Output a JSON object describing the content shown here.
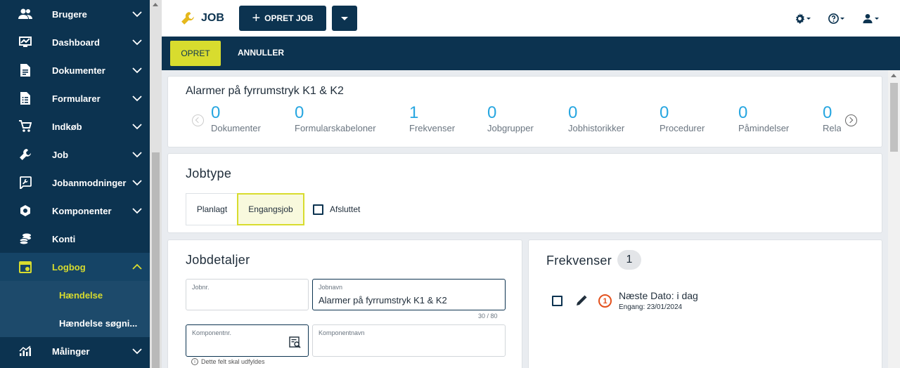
{
  "sidebar": {
    "items": [
      {
        "label": "Brugere",
        "icon": "users-icon"
      },
      {
        "label": "Dashboard",
        "icon": "dashboard-icon"
      },
      {
        "label": "Dokumenter",
        "icon": "document-icon"
      },
      {
        "label": "Formularer",
        "icon": "form-icon"
      },
      {
        "label": "Indkøb",
        "icon": "cart-icon"
      },
      {
        "label": "Job",
        "icon": "wrench-icon"
      },
      {
        "label": "Jobanmodninger",
        "icon": "request-icon"
      },
      {
        "label": "Komponenter",
        "icon": "component-icon"
      },
      {
        "label": "Konti",
        "icon": "coins-icon"
      },
      {
        "label": "Logbog",
        "icon": "logbook-icon"
      },
      {
        "label": "Målinger",
        "icon": "chart-icon"
      }
    ],
    "subitems": [
      {
        "label": "Hændelse"
      },
      {
        "label": "Hændelse søgni..."
      }
    ]
  },
  "topbar": {
    "title": "JOB",
    "create_label": "OPRET JOB"
  },
  "actionbar": {
    "create": "OPRET",
    "cancel": "ANNULLER"
  },
  "summary": {
    "title": "Alarmer på fyrrumstryk K1 & K2",
    "stats": [
      {
        "value": "0",
        "label": "Dokumenter"
      },
      {
        "value": "0",
        "label": "Formularskabeloner"
      },
      {
        "value": "1",
        "label": "Frekvenser"
      },
      {
        "value": "0",
        "label": "Jobgrupper"
      },
      {
        "value": "0",
        "label": "Jobhistorikker"
      },
      {
        "value": "0",
        "label": "Procedurer"
      },
      {
        "value": "0",
        "label": "Påmindelser"
      },
      {
        "value": "0",
        "label": "Rela"
      }
    ]
  },
  "jobtype": {
    "title": "Jobtype",
    "options": [
      "Planlagt",
      "Engangsjob"
    ],
    "selected": "Engangsjob",
    "closed_label": "Afsluttet"
  },
  "details": {
    "title": "Jobdetaljer",
    "jobnr_label": "Jobnr.",
    "jobnr_value": "",
    "jobname_label": "Jobnavn",
    "jobname_value": "Alarmer på fyrrumstryk K1 & K2",
    "jobname_counter": "30 / 80",
    "compnr_label": "Komponentnr.",
    "compname_label": "Komponentnavn",
    "required_hint": "Dette felt skal udfyldes"
  },
  "frequencies": {
    "title": "Frekvenser",
    "count": "1",
    "items": [
      {
        "number": "1",
        "title": "Næste Dato: i dag",
        "subtitle": "Engang: 23/01/2024"
      }
    ]
  },
  "colors": {
    "navy": "#0c3350",
    "accent": "#d8dc2e",
    "stat_blue": "#27a6e0",
    "freq_orange": "#e3501c"
  }
}
